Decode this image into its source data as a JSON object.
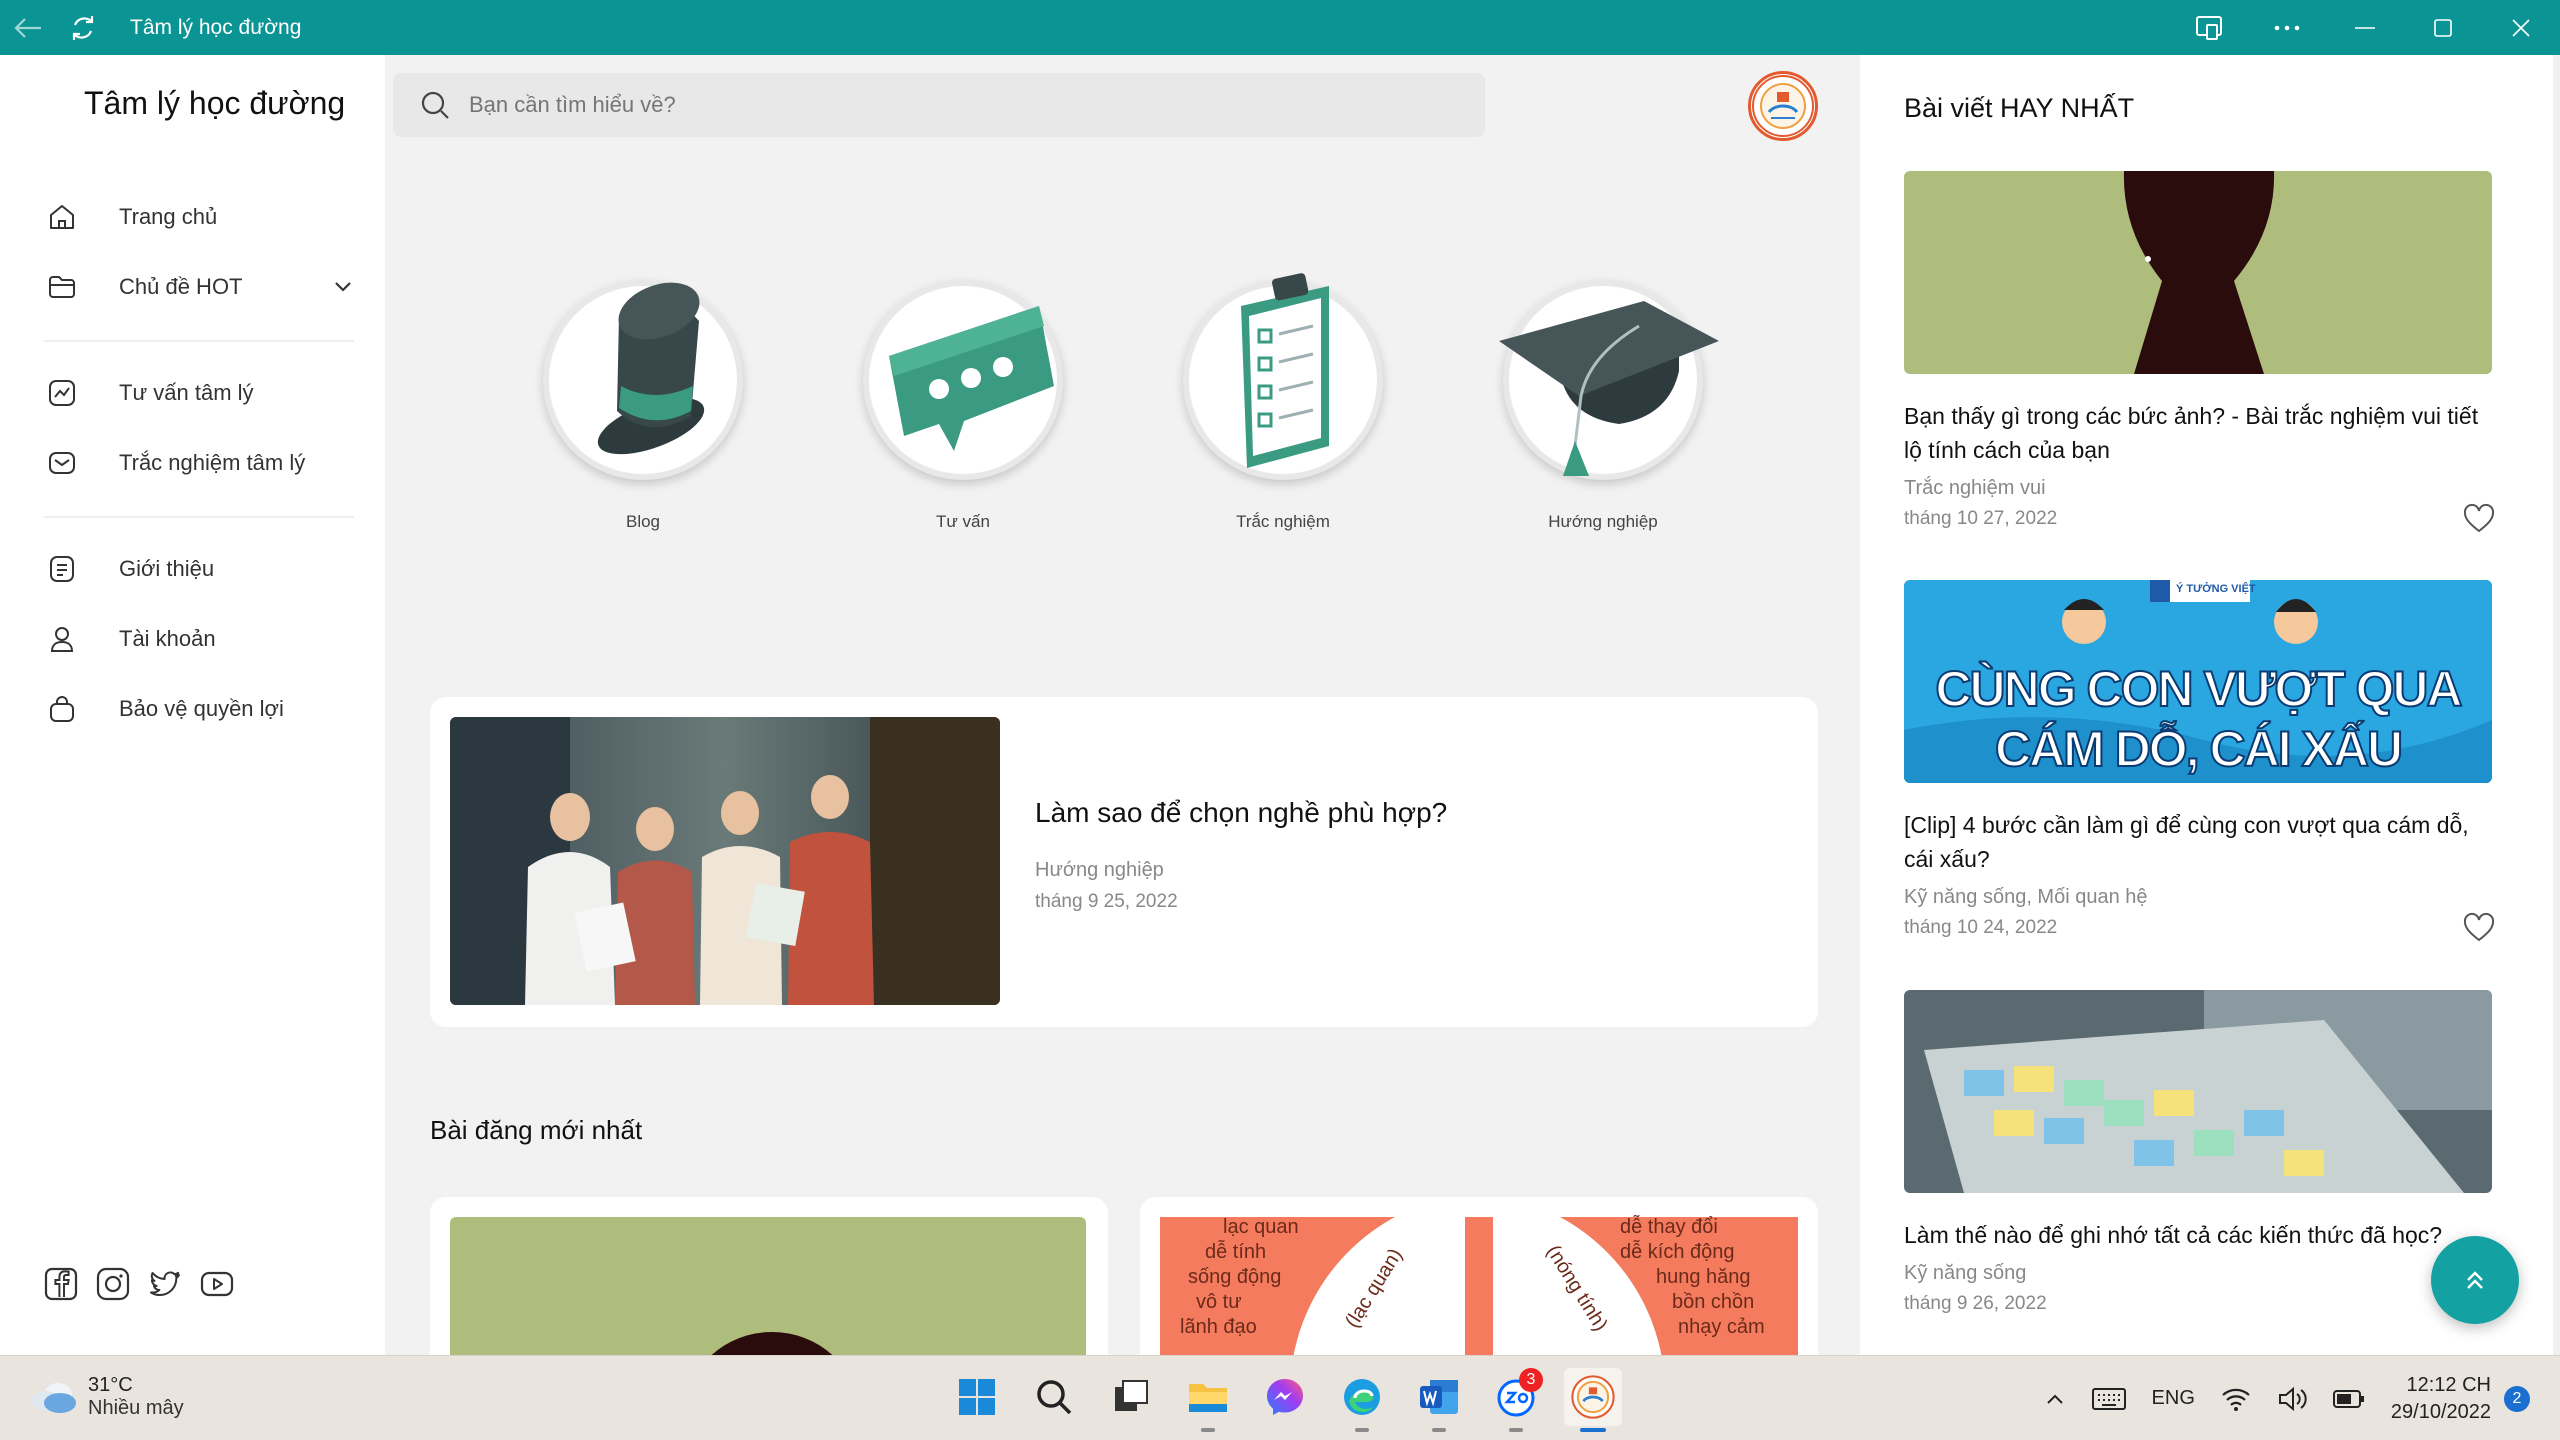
{
  "window": {
    "title": "Tâm lý học đường"
  },
  "sidebar": {
    "brand": "Tâm lý học đường",
    "items": [
      {
        "label": "Trang chủ",
        "icon": "home-icon"
      },
      {
        "label": "Chủ đề HOT",
        "icon": "folder-icon"
      },
      {
        "label": "Tư vấn tâm lý",
        "icon": "chart-icon"
      },
      {
        "label": "Trắc nghiệm tâm lý",
        "icon": "mail-icon"
      },
      {
        "label": "Giới thiệu",
        "icon": "document-icon"
      },
      {
        "label": "Tài khoản",
        "icon": "user-icon"
      },
      {
        "label": "Bảo vệ quyền lợi",
        "icon": "bag-icon"
      }
    ]
  },
  "search": {
    "placeholder": "Bạn cần tìm hiểu về?"
  },
  "categories": [
    {
      "label": "Blog"
    },
    {
      "label": "Tư vấn"
    },
    {
      "label": "Trắc nghiệm"
    },
    {
      "label": "Hướng nghiệp"
    }
  ],
  "feature": {
    "title": "Làm sao để chọn nghề phù hợp?",
    "category": "Hướng nghiệp",
    "date": "tháng 9 25, 2022"
  },
  "latest": {
    "title": "Bài đăng mới nhất",
    "card2_texts": {
      "left": [
        "lạc quan",
        "dễ tính",
        "sống động",
        "vô tư",
        "lãnh đạo"
      ],
      "left_curve": "(lạc quan)",
      "right_curve": "(nóng tính)",
      "right": [
        "dễ thay đổi",
        "dễ kích động",
        "hung hăng",
        "bồn chồn",
        "nhạy cảm"
      ]
    }
  },
  "right_panel": {
    "title": "Bài viết HAY NHẤT",
    "posts": [
      {
        "title": "Bạn thấy gì trong các bức ảnh? - Bài trắc nghiệm vui tiết lộ tính cách của bạn",
        "category": "Trắc nghiệm vui",
        "date": "tháng 10 27, 2022"
      },
      {
        "title": "[Clip] 4 bước cần làm gì để cùng con vượt qua cám dỗ, cái xấu?",
        "category": "Kỹ năng sống, Mối quan hệ",
        "date": "tháng 10 24, 2022",
        "banner_line1": "CÙNG CON VƯỢT QUA",
        "banner_line2": "CÁM DỖ, CÁI XẤU",
        "banner_tag": "Ý TƯỞNG VIỆT"
      },
      {
        "title": "Làm thế nào để ghi nhớ tất cả các kiến thức đã học?",
        "category": "Kỹ năng sống",
        "date": "tháng 9 26, 2022"
      }
    ]
  },
  "taskbar": {
    "weather_temp": "31°C",
    "weather_cond": "Nhiều mây",
    "zalo_badge": "3",
    "lang": "ENG",
    "time": "12:12 CH",
    "date": "29/10/2022",
    "notifications": "2"
  },
  "colors": {
    "titlebar": "#0b9494",
    "accent": "#14a1a1",
    "coral": "#f47b5e",
    "olive": "#aebd7c"
  }
}
